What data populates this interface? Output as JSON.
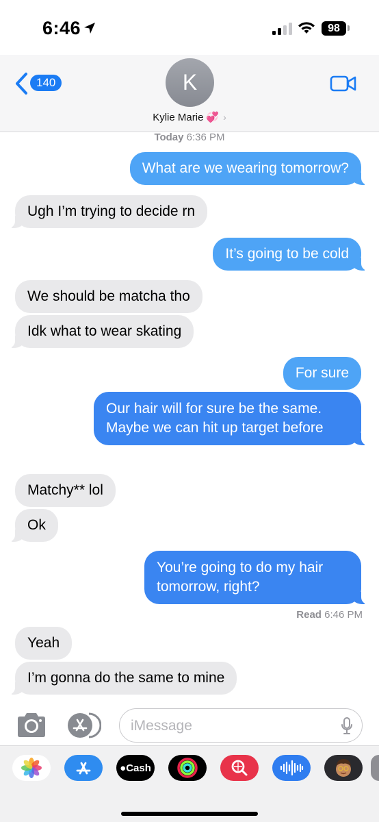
{
  "status_bar": {
    "time": "6:46",
    "battery": "98"
  },
  "header": {
    "back_count": "140",
    "avatar_initial": "K",
    "contact_name": "Kylie Marie",
    "contact_emoji": "💞"
  },
  "timestamp": {
    "day": "Today",
    "time": "6:36 PM"
  },
  "messages": [
    {
      "dir": "out",
      "text": "What are we wearing tomorrow?"
    },
    {
      "dir": "in",
      "text": "Ugh I’m trying to decide rn"
    },
    {
      "dir": "out",
      "text": "It’s going to be cold"
    },
    {
      "dir": "in",
      "text": "We should be matcha tho"
    },
    {
      "dir": "in",
      "text": "Idk what to wear skating"
    },
    {
      "dir": "out",
      "text": "For sure"
    },
    {
      "dir": "out",
      "text": "Our hair will for sure be the same. Maybe we can hit up target before"
    },
    {
      "dir": "in",
      "text": "Matchy** lol"
    },
    {
      "dir": "in",
      "text": "Ok"
    },
    {
      "dir": "out",
      "text": "You’re going to do my hair tomorrow, right?"
    },
    {
      "dir": "in",
      "text": "Yeah"
    },
    {
      "dir": "in",
      "text": "I’m gonna do the same to mine"
    }
  ],
  "read_receipt": {
    "label": "Read",
    "time": "6:46 PM"
  },
  "input": {
    "placeholder": "iMessage",
    "value": ""
  },
  "drawer": {
    "apps": [
      "photos-icon",
      "app-store-icon",
      "cash-icon",
      "fitness-icon",
      "search-icon",
      "voice-memo-icon",
      "memoji-icon",
      "more-icon"
    ],
    "cash_label": "Cash"
  },
  "colors": {
    "blue": "#3a85f1",
    "light_blue": "#4ea4f6",
    "gray_bubble": "#e9e9eb",
    "link": "#1b7cf4"
  }
}
